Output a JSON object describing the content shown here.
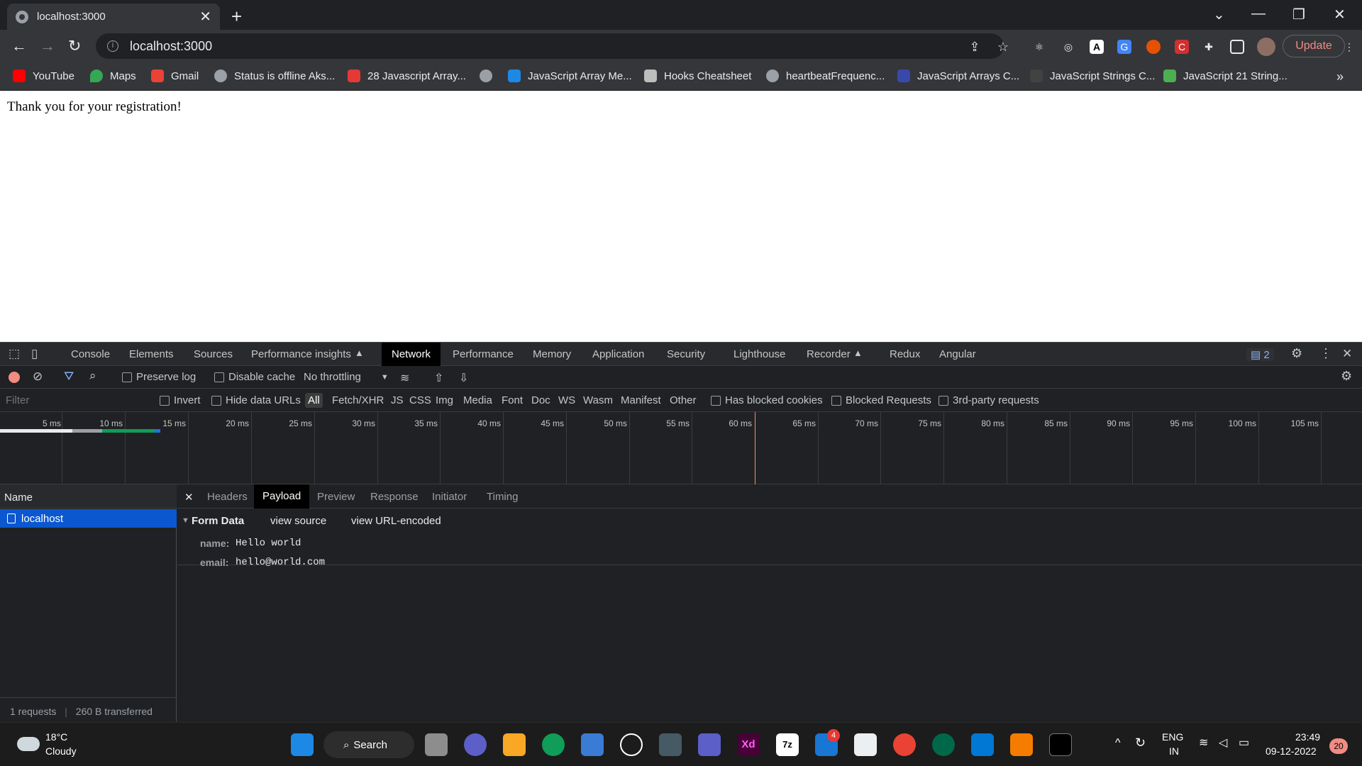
{
  "browser": {
    "tab_title": "localhost:3000",
    "url": "localhost:3000",
    "update_label": "Update",
    "bookmarks": [
      {
        "label": "YouTube",
        "color": "#ff0000"
      },
      {
        "label": "Maps",
        "color": "#34a853"
      },
      {
        "label": "Gmail",
        "color": "#ea4335"
      },
      {
        "label": "Status is offline Aks...",
        "color": "#9aa0a6"
      },
      {
        "label": "28 Javascript Array...",
        "color": "#e53935"
      },
      {
        "label": "",
        "color": "#9aa0a6"
      },
      {
        "label": "JavaScript Array Me...",
        "color": "#1e88e5"
      },
      {
        "label": "Hooks Cheatsheet",
        "color": "#bdbdbd"
      },
      {
        "label": "heartbeatFrequenc...",
        "color": "#9aa0a6"
      },
      {
        "label": "JavaScript Arrays C...",
        "color": "#3949ab"
      },
      {
        "label": "JavaScript Strings C...",
        "color": "#424242"
      },
      {
        "label": "JavaScript 21 String...",
        "color": "#4caf50"
      }
    ]
  },
  "page": {
    "message": "Thank you for your registration!"
  },
  "devtools": {
    "tabs": [
      "Console",
      "Elements",
      "Sources",
      "Performance insights",
      "Network",
      "Performance",
      "Memory",
      "Application",
      "Security",
      "Lighthouse",
      "Recorder",
      "Redux",
      "Angular"
    ],
    "active_tab": "Network",
    "issues_count": "2",
    "controls": {
      "preserve_log": "Preserve log",
      "disable_cache": "Disable cache",
      "throttling": "No throttling"
    },
    "filter_placeholder": "Filter",
    "filter_types": [
      "Invert",
      "Hide data URLs",
      "All",
      "Fetch/XHR",
      "JS",
      "CSS",
      "Img",
      "Media",
      "Font",
      "Doc",
      "WS",
      "Wasm",
      "Manifest",
      "Other",
      "Has blocked cookies",
      "Blocked Requests",
      "3rd-party requests"
    ],
    "timeline_ticks": [
      "5 ms",
      "10 ms",
      "15 ms",
      "20 ms",
      "25 ms",
      "30 ms",
      "35 ms",
      "40 ms",
      "45 ms",
      "50 ms",
      "55 ms",
      "60 ms",
      "65 ms",
      "70 ms",
      "75 ms",
      "80 ms",
      "85 ms",
      "90 ms",
      "95 ms",
      "100 ms",
      "105 ms"
    ],
    "requests_header": "Name",
    "request_name": "localhost",
    "footer_requests": "1 requests",
    "footer_transferred": "260 B transferred",
    "detail_tabs": [
      "Headers",
      "Payload",
      "Preview",
      "Response",
      "Initiator",
      "Timing"
    ],
    "active_detail_tab": "Payload",
    "form_data": {
      "title": "Form Data",
      "view_source": "view source",
      "view_url_encoded": "view URL-encoded",
      "fields": [
        {
          "key": "name:",
          "value": "Hello world"
        },
        {
          "key": "email:",
          "value": "hello@world.com"
        }
      ]
    }
  },
  "taskbar": {
    "weather_temp": "18°C",
    "weather_desc": "Cloudy",
    "search_label": "Search",
    "lang": "ENG",
    "region": "IN",
    "time": "23:49",
    "date": "09-12-2022",
    "notif_count": "20",
    "todo_badge": "4"
  }
}
